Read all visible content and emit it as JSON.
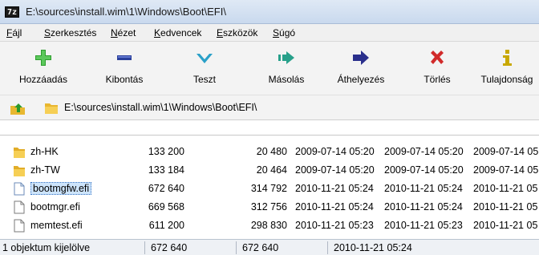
{
  "window": {
    "title": "E:\\sources\\install.wim\\1\\Windows\\Boot\\EFI\\",
    "app_icon_text": "7z"
  },
  "menu": [
    "Fájl",
    "Szerkesztés",
    "Nézet",
    "Kedvencek",
    "Eszközök",
    "Súgó"
  ],
  "toolbar": [
    {
      "label": "Hozzáadás",
      "icon": "plus-icon",
      "color": "#2e9e2e"
    },
    {
      "label": "Kibontás",
      "icon": "minus-icon",
      "color": "#2a3f9a"
    },
    {
      "label": "Teszt",
      "icon": "check-icon",
      "color": "#2aa0c8"
    },
    {
      "label": "Másolás",
      "icon": "copy-arrow-icon",
      "color": "#27a08a"
    },
    {
      "label": "Áthelyezés",
      "icon": "move-arrow-icon",
      "color": "#2a2f8c"
    },
    {
      "label": "Törlés",
      "icon": "delete-x-icon",
      "color": "#d12a2a"
    },
    {
      "label": "Tulajdonság",
      "icon": "info-icon",
      "color": "#c8a800"
    }
  ],
  "address": {
    "path": "E:\\sources\\install.wim\\1\\Windows\\Boot\\EFI\\"
  },
  "files": [
    {
      "name": "zh-HK",
      "type": "folder",
      "size": "133 200",
      "packed": "20 480",
      "modified": "2009-07-14 05:20",
      "created": "2009-07-14 05:20",
      "accessed": "2009-07-14 05"
    },
    {
      "name": "zh-TW",
      "type": "folder",
      "size": "133 184",
      "packed": "20 464",
      "modified": "2009-07-14 05:20",
      "created": "2009-07-14 05:20",
      "accessed": "2009-07-14 05"
    },
    {
      "name": "bootmgfw.efi",
      "type": "file",
      "selected": true,
      "size": "672 640",
      "packed": "314 792",
      "modified": "2010-11-21 05:24",
      "created": "2010-11-21 05:24",
      "accessed": "2010-11-21 05"
    },
    {
      "name": "bootmgr.efi",
      "type": "file",
      "size": "669 568",
      "packed": "312 756",
      "modified": "2010-11-21 05:24",
      "created": "2010-11-21 05:24",
      "accessed": "2010-11-21 05"
    },
    {
      "name": "memtest.efi",
      "type": "file",
      "size": "611 200",
      "packed": "298 830",
      "modified": "2010-11-21 05:23",
      "created": "2010-11-21 05:23",
      "accessed": "2010-11-21 05"
    }
  ],
  "status": {
    "selection": "1 objektum kijelölve",
    "size": "672 640",
    "packed": "672 640",
    "date": "2010-11-21 05:24"
  }
}
